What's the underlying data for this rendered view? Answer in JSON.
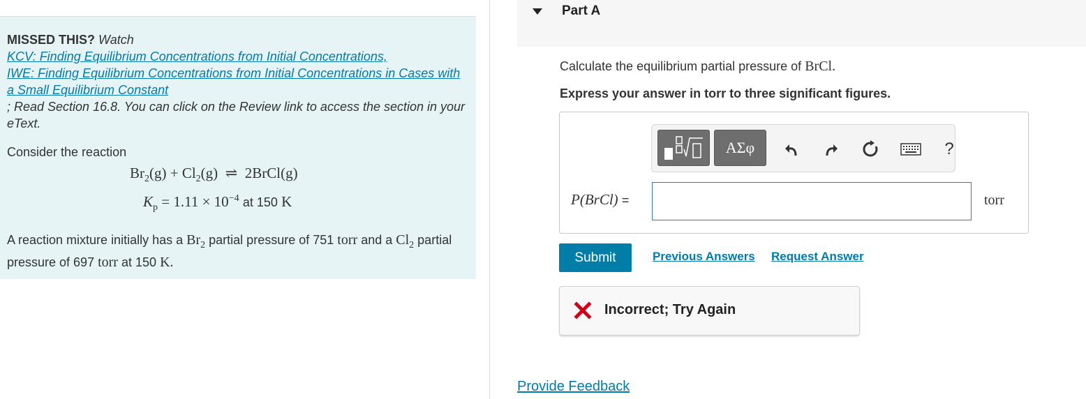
{
  "missed": {
    "heading": "MISSED THIS?",
    "watch": "Watch",
    "link1": "KCV: Finding Equilibrium Concentrations from Initial Concentrations,",
    "link2": "IWE: Finding Equilibrium Concentrations from Initial Concentrations in Cases with a Small Equilibrium Constant",
    "read": "; Read Section 16.8. You can click on the Review link to access the section in your eText."
  },
  "problem": {
    "consider": "Consider the reaction",
    "kp_value": "1.11",
    "kp_exp": "−4",
    "kp_at": "at 150",
    "kp_temp_unit": "K",
    "mix_a": "A reaction mixture initially has a",
    "mix_b": "partial pressure of 751",
    "mix_c": "and a",
    "mix_d": "partial pressure of 697",
    "mix_e": "at 150",
    "torr": "torr"
  },
  "part": {
    "title": "Part A",
    "question_prefix": "Calculate the equilibrium partial pressure of",
    "question_species": "BrCl",
    "instruction": "Express your answer in torr to three significant figures."
  },
  "answer": {
    "variable": "P(BrCl)",
    "equals": "=",
    "value": "",
    "unit": "torr"
  },
  "toolbar": {
    "greek_label": "ΑΣφ",
    "help_label": "?",
    "icons": [
      "templates-icon",
      "greek-letters-icon",
      "undo-icon",
      "redo-icon",
      "reset-icon",
      "keyboard-icon",
      "help-icon"
    ]
  },
  "actions": {
    "submit": "Submit",
    "previous_answers": "Previous Answers",
    "request_answer": "Request Answer"
  },
  "feedback": {
    "status": "Incorrect; Try Again",
    "status_color": "#d0021b"
  },
  "footer": {
    "provide_feedback": "Provide Feedback"
  },
  "colors": {
    "link": "#007bab",
    "submit_bg": "#007ea8",
    "info_bg": "#e6f4f5"
  }
}
